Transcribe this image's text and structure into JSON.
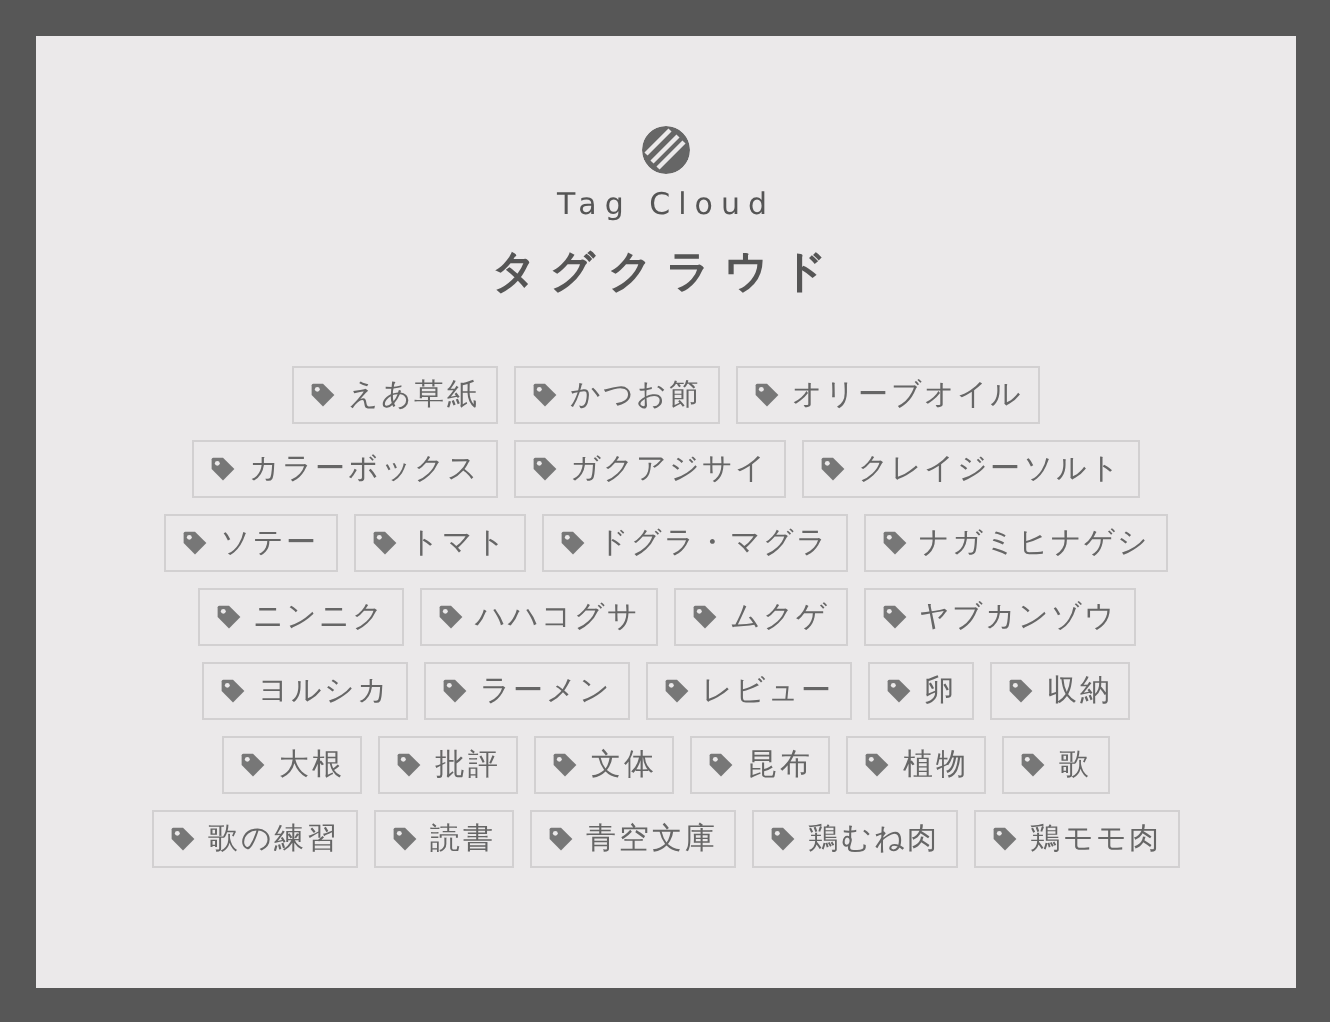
{
  "header": {
    "subtitle": "Tag Cloud",
    "title": "タグクラウド"
  },
  "tag_rows": [
    {
      "tags": [
        "えあ草紙",
        "かつお節",
        "オリーブオイル"
      ]
    },
    {
      "tags": [
        "カラーボックス",
        "ガクアジサイ",
        "クレイジーソルト"
      ]
    },
    {
      "tags": [
        "ソテー",
        "トマト",
        "ドグラ・マグラ",
        "ナガミヒナゲシ"
      ]
    },
    {
      "tags": [
        "ニンニク",
        "ハハコグサ",
        "ムクゲ",
        "ヤブカンゾウ"
      ]
    },
    {
      "tags": [
        "ヨルシカ",
        "ラーメン",
        "レビュー",
        "卵",
        "収納"
      ]
    },
    {
      "tags": [
        "大根",
        "批評",
        "文体",
        "昆布",
        "植物",
        "歌"
      ]
    },
    {
      "tags": [
        "歌の練習",
        "読書",
        "青空文庫",
        "鶏むね肉",
        "鶏モモ肉"
      ]
    }
  ]
}
